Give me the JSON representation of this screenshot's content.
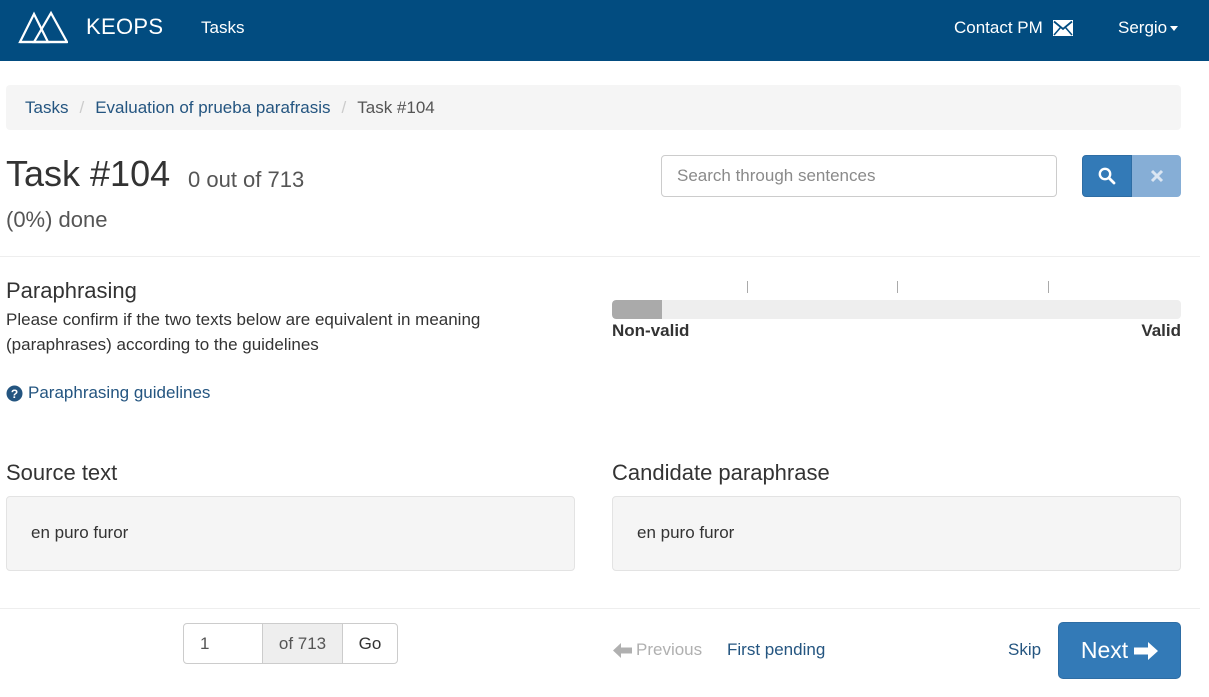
{
  "navbar": {
    "brand": "KEOPS",
    "tasks_label": "Tasks",
    "contact_label": "Contact PM",
    "user_label": "Sergio",
    "background_color": "#024c80"
  },
  "breadcrumb": {
    "items": [
      "Tasks",
      "Evaluation of prueba parafrasis"
    ],
    "separator": "/",
    "current": "Task #104"
  },
  "task": {
    "title": "Task #104",
    "count_text": "0 out of 713",
    "done_text": "(0%) done"
  },
  "search": {
    "placeholder": "Search through sentences",
    "search_icon": "search-icon",
    "clear_icon": "close-icon"
  },
  "paraphrasing": {
    "title": "Paraphrasing",
    "description": "Please confirm if the two texts below are equivalent in meaning (paraphrases) according to the guidelines",
    "guidelines_link": "Paraphrasing guidelines",
    "guidelines_icon": "question-circle-icon"
  },
  "slider": {
    "min_label": "Non-valid",
    "max_label": "Valid",
    "level": 0.088
  },
  "source": {
    "heading": "Source text",
    "text": "en puro furor"
  },
  "candidate": {
    "heading": "Candidate paraphrase",
    "text": "en puro furor"
  },
  "pagination": {
    "page_value": "1",
    "of_text": "of 713",
    "go_label": "Go",
    "previous_label": "Previous",
    "first_pending_label": "First pending",
    "skip_label": "Skip",
    "next_label": "Next"
  },
  "colors": {
    "accent": "#337ab7",
    "link": "#245580",
    "disabled_button": "#86aed6"
  }
}
